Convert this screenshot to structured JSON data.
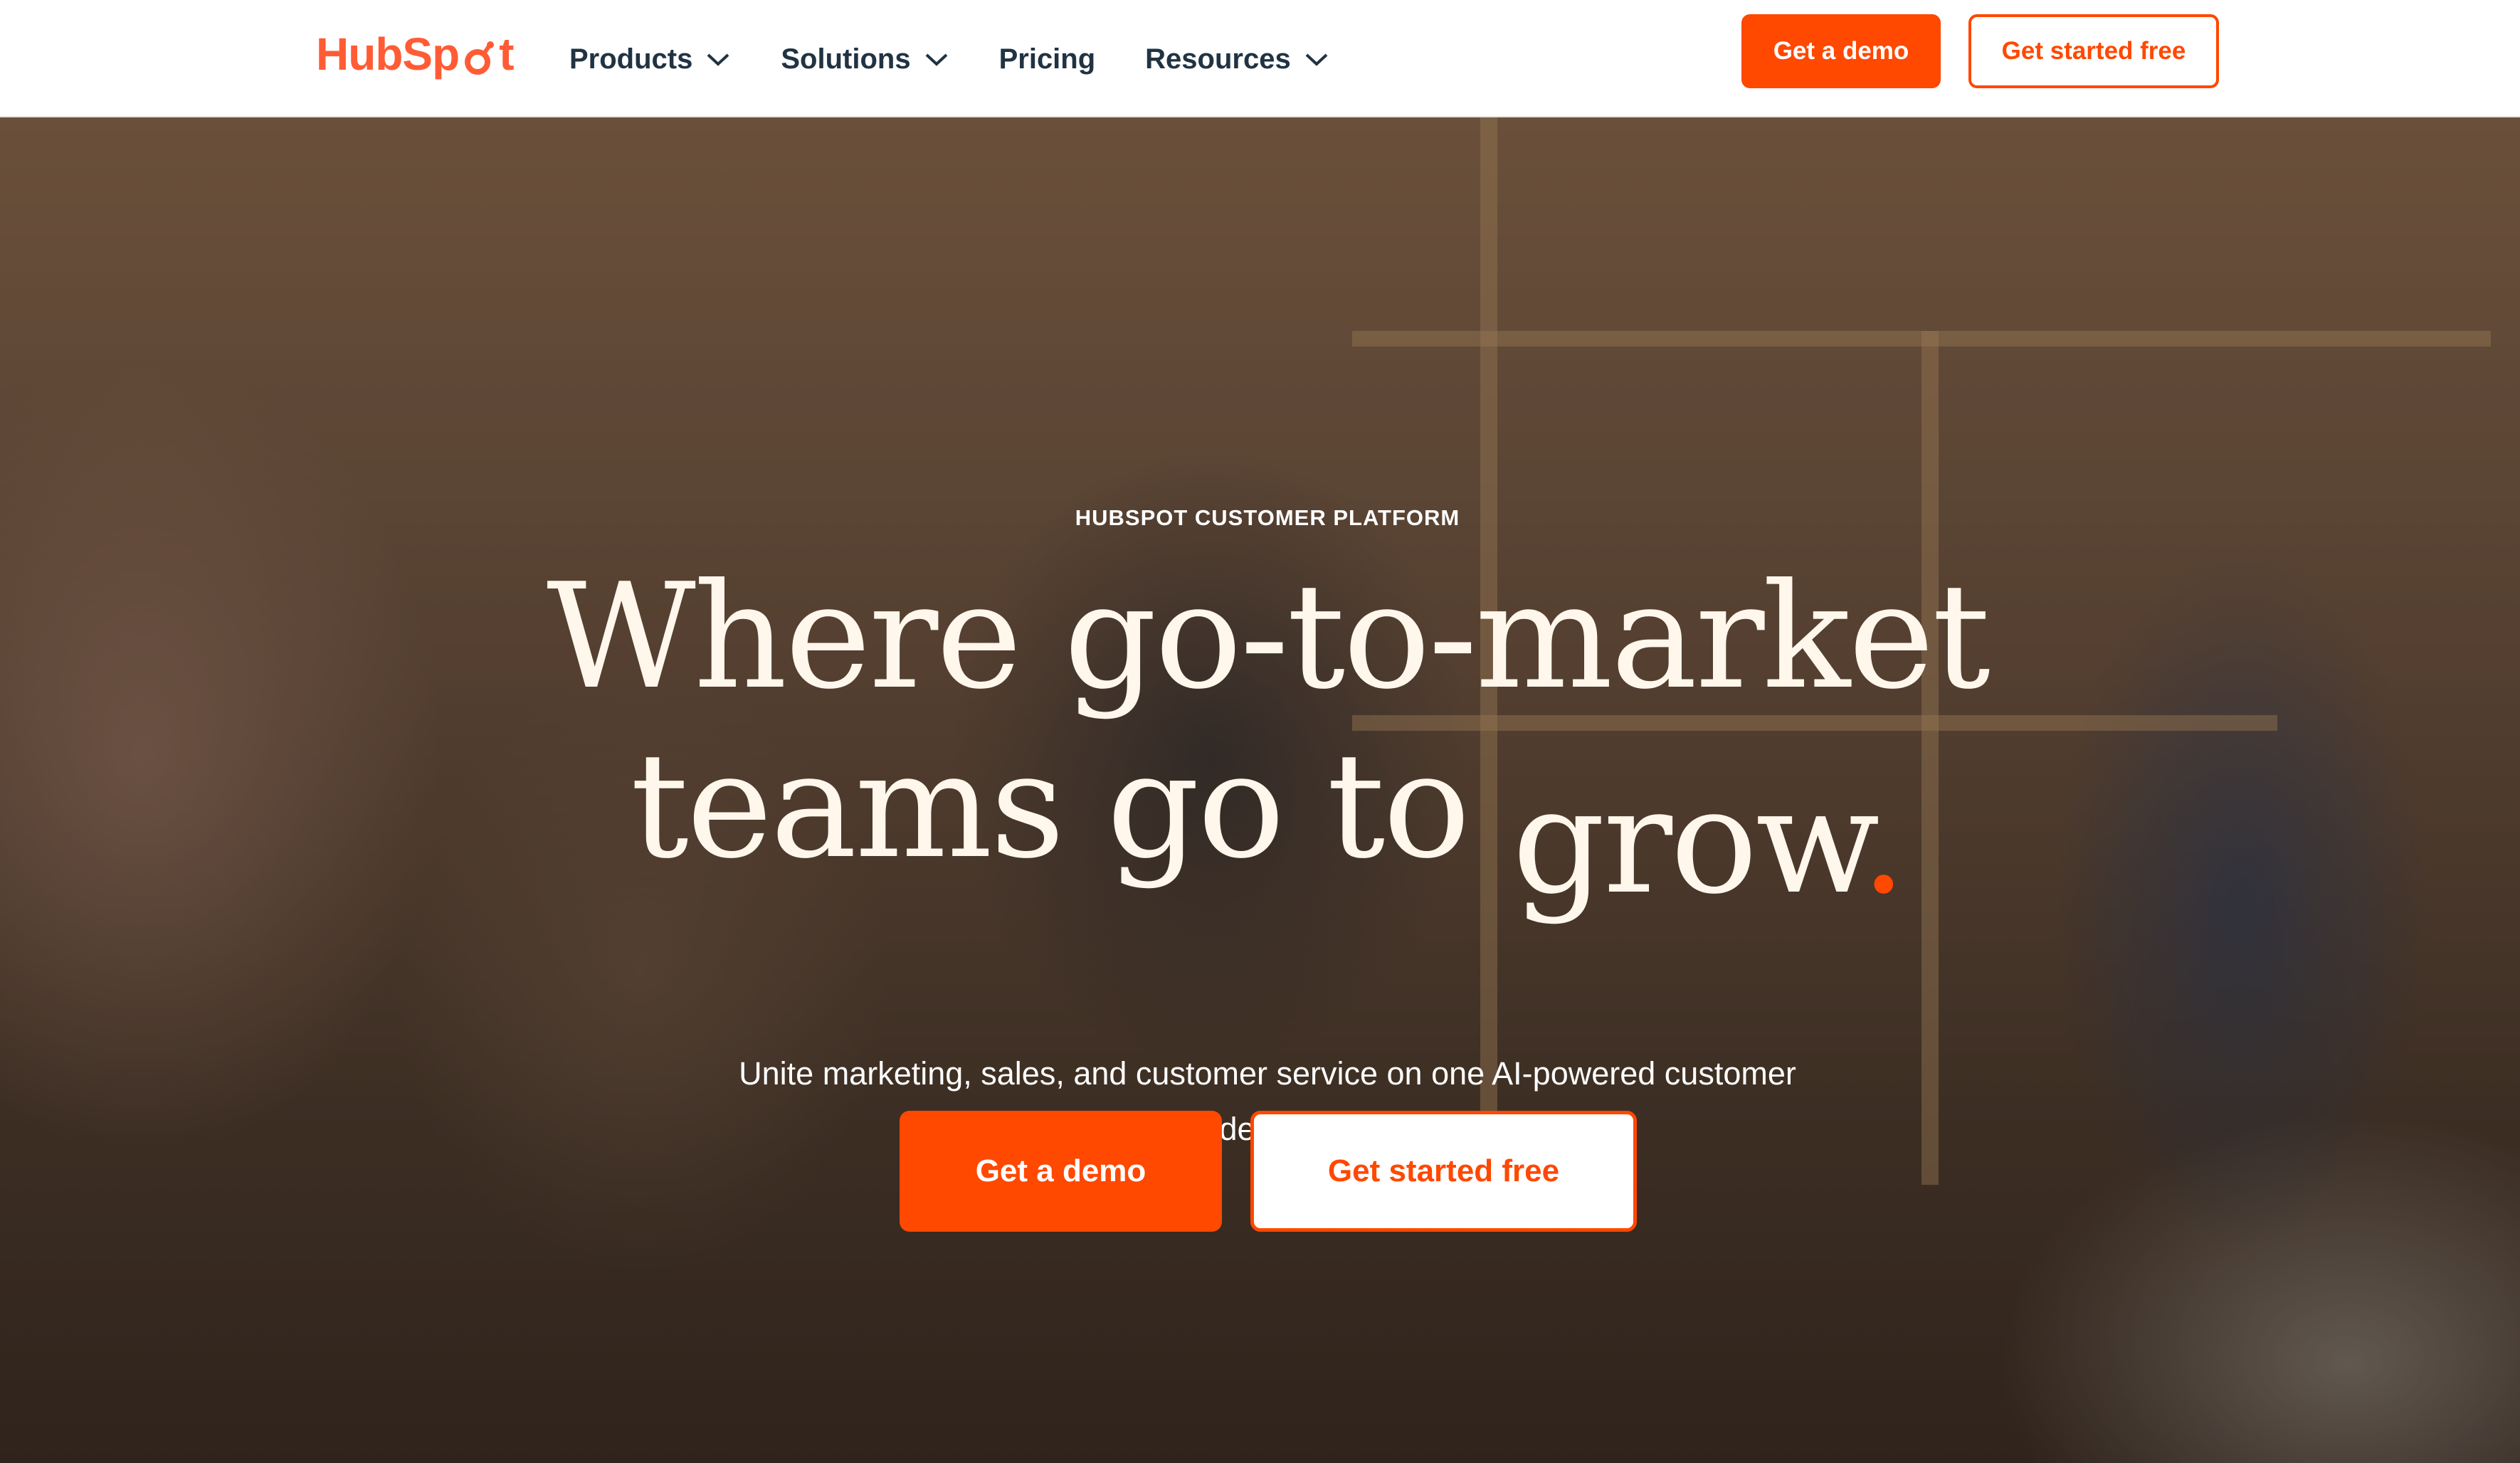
{
  "nav": {
    "logo": "HubSpot",
    "items": [
      {
        "label": "Products",
        "has_dropdown": true
      },
      {
        "label": "Solutions",
        "has_dropdown": true
      },
      {
        "label": "Pricing",
        "has_dropdown": false
      },
      {
        "label": "Resources",
        "has_dropdown": true
      }
    ],
    "demo_label": "Get a demo",
    "free_label": "Get started free"
  },
  "hero": {
    "eyebrow": "HUBSPOT CUSTOMER PLATFORM",
    "headline_line1": "Where go-to-market",
    "headline_line2_prefix": "teams go to ",
    "headline_accent_word": "grow",
    "headline_dot": ".",
    "subtext": "Unite marketing, sales, and customer service on one AI-powered customer platform that delivers results fast.",
    "demo_label": "Get a demo",
    "free_label": "Get started free"
  },
  "colors": {
    "brand_orange": "#ff4800",
    "logo_orange": "#ff5c35",
    "nav_text": "#213343"
  },
  "icons": [
    "hubspot-sprocket-icon",
    "chevron-down-icon"
  ]
}
